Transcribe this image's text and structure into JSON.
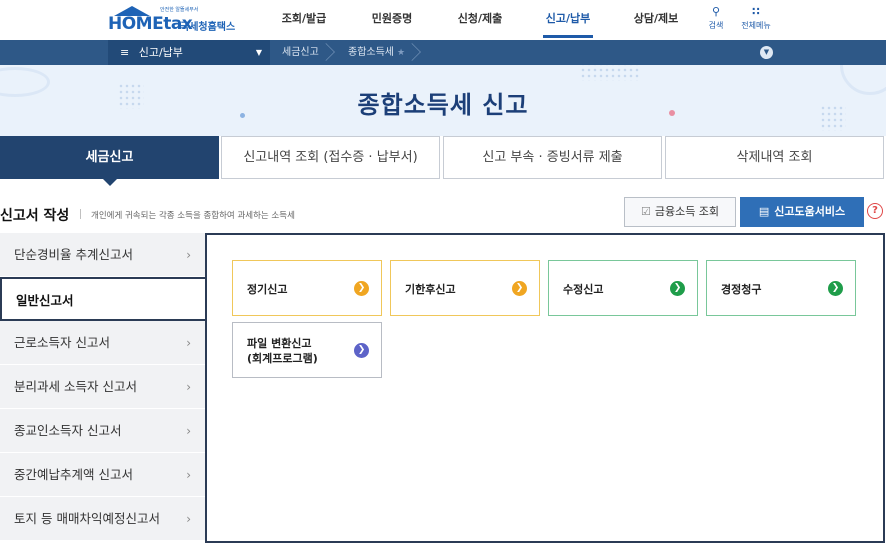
{
  "header": {
    "logo_sub": "안전한 알뜰세무서",
    "logo_main": "HOMEtax",
    "logo_kr": "국세청홈택스",
    "nav": [
      "조회/발급",
      "민원증명",
      "신청/제출",
      "신고/납부",
      "상담/제보"
    ],
    "active_nav_index": 3,
    "search_label": "검색",
    "menu_label": "전체메뉴",
    "accent_color": "#1e5aa8"
  },
  "breadcrumb": {
    "menu_label": "신고/납부",
    "items": [
      "세금신고",
      "종합소득세"
    ],
    "bar_color": "#2e5887"
  },
  "page": {
    "title": "종합소득세 신고"
  },
  "tabs": {
    "items": [
      "세금신고",
      "신고내역 조회 (접수증 · 납부서)",
      "신고 부속 · 증빙서류 제출",
      "삭제내역 조회"
    ],
    "active_index": 0
  },
  "section": {
    "title": "신고서 작성",
    "desc": "개인에게 귀속되는 각종 소득을 종합하여 과세하는 소득세",
    "btn_finance": "금융소득 조회",
    "btn_help": "신고도움서비스",
    "help_icon": "?"
  },
  "side_menu": {
    "items": [
      "단순경비율 추계신고서",
      "일반신고서",
      "근로소득자 신고서",
      "분리과세 소득자 신고서",
      "종교인소득자 신고서",
      "중간예납추계액 신고서",
      "토지 등 매매차익예정신고서"
    ],
    "active_index": 1
  },
  "cards": [
    {
      "label": "정기신고",
      "color": "orange"
    },
    {
      "label": "기한후신고",
      "color": "orange"
    },
    {
      "label": "수정신고",
      "color": "green"
    },
    {
      "label": "경정청구",
      "color": "green"
    },
    {
      "label_line1": "파일 변환신고",
      "label_line2": "(회계프로그램)",
      "color": "purple"
    }
  ]
}
